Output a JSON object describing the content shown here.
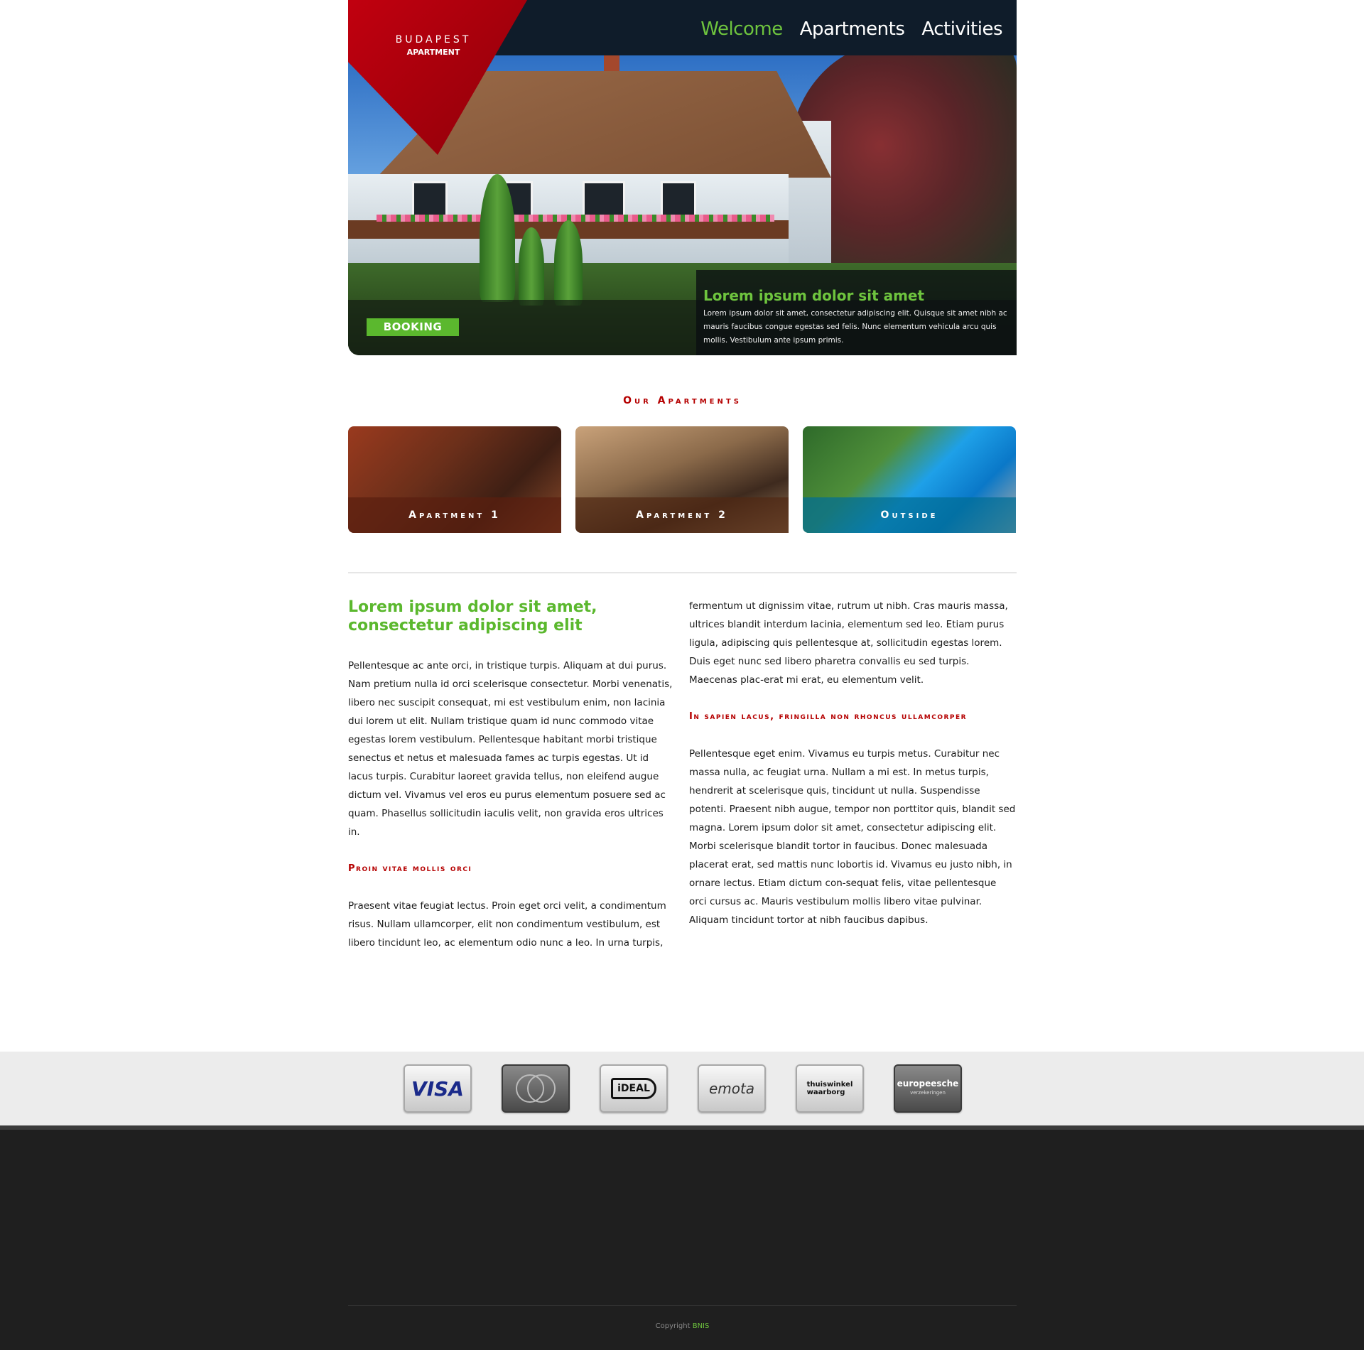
{
  "brand": {
    "line1": "BUDAPEST",
    "line2": "APARTMENT",
    "accent": "#6ec43e",
    "red": "#b50000"
  },
  "nav": {
    "items": [
      {
        "label": "Welcome",
        "active": true
      },
      {
        "label": "Apartments",
        "active": false
      },
      {
        "label": "Activities",
        "active": false
      }
    ]
  },
  "hero": {
    "caption_title": "Lorem ipsum dolor sit amet",
    "caption_text": "Lorem ipsum dolor sit amet, consectetur adipiscing elit. Quisque sit amet nibh ac mauris faucibus congue egestas sed felis. Nunc elementum vehicula arcu quis mollis. Vestibulum ante ipsum primis.",
    "booking_label": "BOOKING"
  },
  "apartments": {
    "title": "Our Apartments",
    "cards": [
      {
        "label": "Apartment 1"
      },
      {
        "label": "Apartment 2"
      },
      {
        "label": "Outside"
      }
    ]
  },
  "content": {
    "heading": "Lorem ipsum dolor sit amet, consectetur adipiscing elit",
    "para1": "Pellentesque ac ante orci, in tristique turpis. Aliquam at dui purus. Nam pretium nulla id orci scelerisque consectetur. Morbi venenatis, libero nec suscipit consequat, mi est vestibulum enim, non lacinia dui lorem ut elit. Nullam tristique quam id nunc commodo vitae egestas lorem vestibulum. Pellentesque habitant morbi tristique senectus et netus et malesuada fames ac turpis egestas. Ut id lacus turpis. Curabitur laoreet gravida tellus, non eleifend augue dictum vel. Vivamus vel eros eu purus elementum posuere sed ac quam. Phasellus sollicitudin iaculis velit, non gravida eros ultrices in.",
    "subheading1": "Proin vitae mollis orci",
    "para2": "Praesent vitae feugiat lectus. Proin eget orci velit, a condimentum risus. Nullam ullamcorper, elit non condimentum vestibulum, est libero tincidunt leo, ac elementum odio nunc a leo. In urna turpis,",
    "para3": "fermentum ut dignissim vitae, rutrum ut nibh. Cras mauris massa, ultrices blandit interdum lacinia, elementum sed leo. Etiam purus ligula, adipiscing quis pellentesque at, sollicitudin egestas lorem. Duis eget nunc sed libero pharetra convallis eu sed turpis. Maecenas plac-erat mi erat, eu elementum velit.",
    "subheading2": "In sapien lacus, fringilla non rhoncus ullamcorper",
    "para4": "Pellentesque eget enim. Vivamus eu turpis metus. Curabitur nec massa nulla, ac feugiat urna. Nullam a mi est. In metus turpis, hendrerit at scelerisque quis, tincidunt ut nulla. Suspendisse potenti. Praesent nibh augue, tempor non porttitor quis, blandit sed magna. Lorem ipsum dolor sit amet, consectetur adipiscing elit. Morbi scelerisque blandit tortor in faucibus. Donec malesuada placerat erat, sed mattis nunc lobortis id. Vivamus eu justo nibh, in ornare lectus. Etiam dictum con-sequat felis, vitae pellentesque orci cursus ac. Mauris vestibulum mollis libero vitae pulvinar. Aliquam tincidunt tortor at nibh faucibus dapibus."
  },
  "payments": {
    "visa": "VISA",
    "ideal": "iDEAL",
    "emota": "emota",
    "thuiswinkel_1": "thuiswinkel",
    "thuiswinkel_2": "waarborg",
    "europeesche_1": "europeesche",
    "europeesche_2": "verzekeringen"
  },
  "footer": {
    "copyright_prefix": "Copyright",
    "copyright_link": "BNIS"
  }
}
